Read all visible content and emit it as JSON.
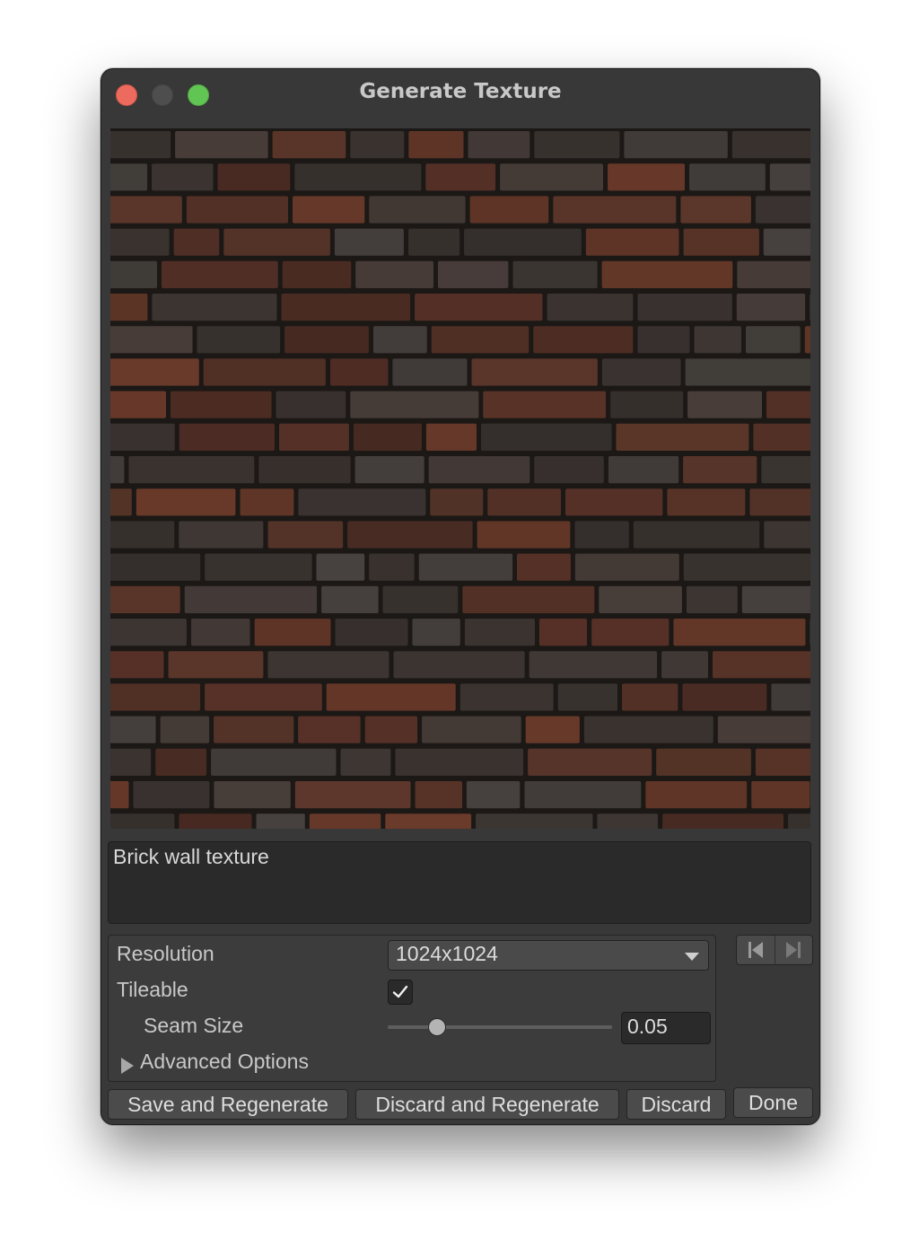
{
  "window": {
    "title": "Generate Texture"
  },
  "preview": {
    "description_icon": "brick-wall-texture-image",
    "colors": {
      "mortar": "#1b1816",
      "brick_red": "#5a3328",
      "brick_dark": "#3b3431",
      "brick_grey": "#47423f",
      "brick_rust": "#6a3a2a"
    }
  },
  "prompt": {
    "value": "Brick wall texture"
  },
  "settings": {
    "resolution_label": "Resolution",
    "resolution_value": "1024x1024",
    "tileable_label": "Tileable",
    "tileable_checked": true,
    "seam_size_label": "Seam Size",
    "seam_size_value": "0.05",
    "seam_size_slider": 0.2,
    "advanced_label": "Advanced Options"
  },
  "nav": {
    "first_icon": "skip-to-first-icon",
    "next_icon": "skip-to-last-icon"
  },
  "buttons": {
    "save_regenerate": "Save and Regenerate",
    "discard_regenerate": "Discard and Regenerate",
    "discard": "Discard",
    "done": "Done"
  }
}
